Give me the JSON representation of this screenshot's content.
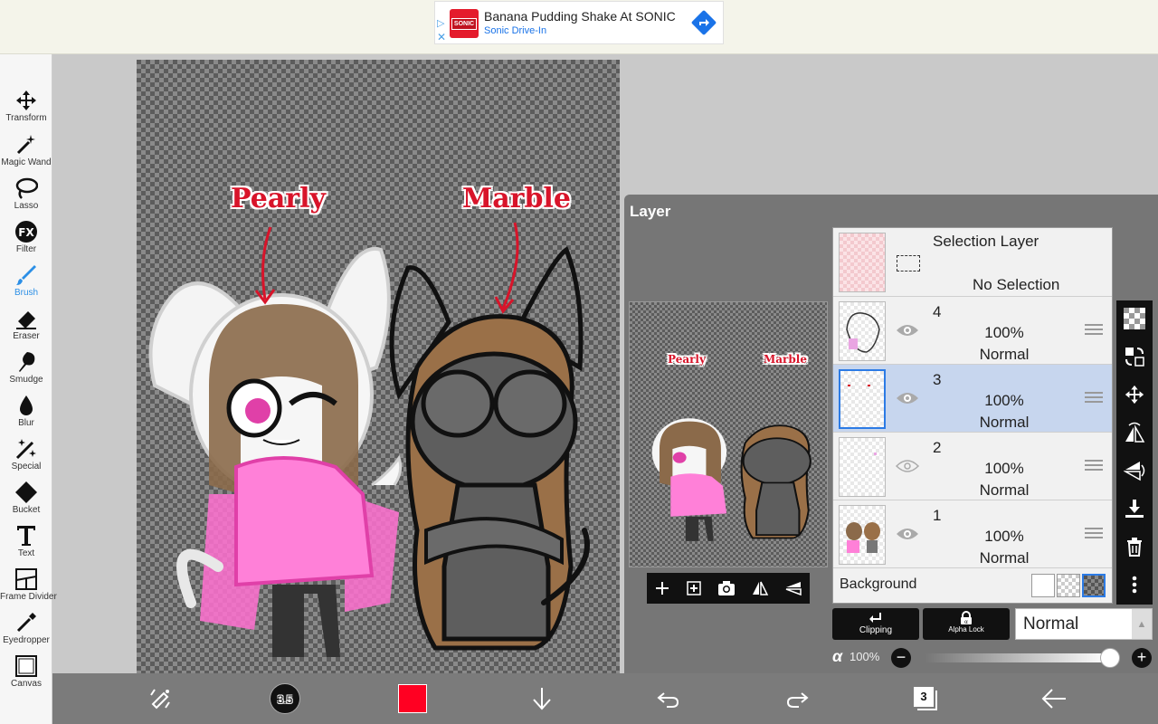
{
  "ad": {
    "title": "Banana Pudding Shake At SONIC",
    "subtitle": "Sonic Drive-In",
    "logo_text": "SONIC",
    "adchoices_icon": "adchoices-icon",
    "close_icon": "close-icon",
    "cta_icon": "directions-icon"
  },
  "toolbar": {
    "tools": [
      {
        "label": "Transform",
        "icon": "move-icon"
      },
      {
        "label": "Magic Wand",
        "icon": "magic-wand-icon"
      },
      {
        "label": "Lasso",
        "icon": "lasso-icon"
      },
      {
        "label": "Filter",
        "icon": "fx-icon"
      },
      {
        "label": "Brush",
        "icon": "brush-icon"
      },
      {
        "label": "Eraser",
        "icon": "eraser-icon"
      },
      {
        "label": "Smudge",
        "icon": "smudge-icon"
      },
      {
        "label": "Blur",
        "icon": "blur-drop-icon"
      },
      {
        "label": "Special",
        "icon": "special-wand-icon"
      },
      {
        "label": "Bucket",
        "icon": "bucket-icon"
      },
      {
        "label": "Text",
        "icon": "text-icon"
      },
      {
        "label": "Frame Divider",
        "icon": "frame-divider-icon"
      },
      {
        "label": "Eyedropper",
        "icon": "eyedropper-icon"
      },
      {
        "label": "Canvas",
        "icon": "canvas-icon"
      }
    ],
    "active_tool": "Brush",
    "active_color": "#2c8fe6"
  },
  "canvas": {
    "label_left": "Pearly",
    "label_right": "Marble",
    "label_color": "#d8142a"
  },
  "bottom_bar": {
    "brush_size": "3.5",
    "primary_color": "#ff0022",
    "layer_count": "3"
  },
  "layer_panel": {
    "title": "Layer",
    "selection_layer": {
      "name": "Selection Layer",
      "status": "No Selection"
    },
    "layers": [
      {
        "number": "4",
        "opacity": "100%",
        "mode": "Normal",
        "visible": true,
        "selected": false
      },
      {
        "number": "3",
        "opacity": "100%",
        "mode": "Normal",
        "visible": true,
        "selected": true
      },
      {
        "number": "2",
        "opacity": "100%",
        "mode": "Normal",
        "visible": false,
        "selected": false
      },
      {
        "number": "1",
        "opacity": "100%",
        "mode": "Normal",
        "visible": true,
        "selected": false
      }
    ],
    "background_label": "Background",
    "clipping_label": "Clipping",
    "alpha_lock_label": "Alpha Lock",
    "blend_mode": "Normal",
    "opacity_symbol": "α",
    "opacity_value": "100%",
    "opacity_level": 1.0
  },
  "preview": {
    "label_left": "Pearly",
    "label_right": "Marble"
  }
}
